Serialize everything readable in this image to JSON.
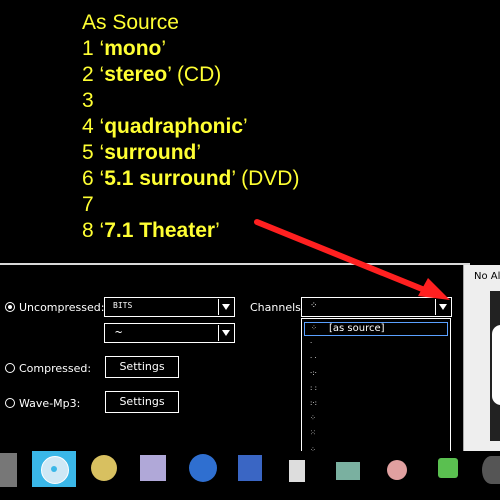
{
  "annotation": {
    "lines": [
      {
        "prefix": "As Source",
        "bold": "",
        "suffix": ""
      },
      {
        "prefix": "1 ‘",
        "bold": "mono",
        "suffix": "’"
      },
      {
        "prefix": "2 ‘",
        "bold": "stereo",
        "suffix": "’ (CD)"
      },
      {
        "prefix": "3",
        "bold": "",
        "suffix": ""
      },
      {
        "prefix": "4 ‘",
        "bold": "quadraphonic",
        "suffix": "’"
      },
      {
        "prefix": "5 ‘",
        "bold": "surround",
        "suffix": "’"
      },
      {
        "prefix": "6 ‘",
        "bold": "5.1 surround",
        "suffix": "’ (DVD)"
      },
      {
        "prefix": "7",
        "bold": "",
        "suffix": ""
      },
      {
        "prefix": "8 ‘",
        "bold": "7.1 Theater",
        "suffix": "’"
      }
    ],
    "color": "#ffff33",
    "arrow_color": "#ff2020"
  },
  "panel": {
    "uncompressed_label": "Uncompressed:",
    "uncompressed_checked": true,
    "bits_value": "BITS",
    "wave_value": "~",
    "channels_label": "Channels",
    "channels_value": "",
    "compressed_label": "Compressed:",
    "compressed_settings": "Settings",
    "wavemp3_label": "Wave-Mp3:",
    "wavemp3_settings": "Settings"
  },
  "dropdown": {
    "items": [
      {
        "label": "[as source]",
        "selected": true
      },
      {
        "label": "",
        "selected": false
      },
      {
        "label": "",
        "selected": false
      },
      {
        "label": "",
        "selected": false
      },
      {
        "label": "",
        "selected": false
      },
      {
        "label": "",
        "selected": false
      },
      {
        "label": "",
        "selected": false
      },
      {
        "label": "",
        "selected": false
      },
      {
        "label": "",
        "selected": false
      }
    ]
  },
  "right_window": {
    "title": "No Al"
  },
  "taskbar": {
    "icons": [
      "speaker-icon",
      "cd-icon",
      "dvd-icon",
      "editor-icon",
      "globe-icon",
      "word-icon",
      "calculator-icon",
      "window-icon",
      "game-icon",
      "chat-icon",
      "media-icon"
    ]
  },
  "colors": {
    "selection_border": "#5aa0ff",
    "taskbar_highlight": "#3ab7e8"
  }
}
